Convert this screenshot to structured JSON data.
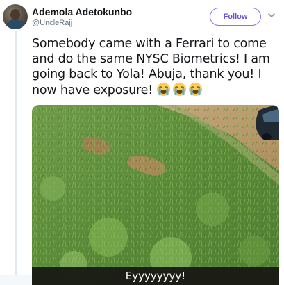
{
  "author": {
    "display_name": "Ademola Adetokunbo",
    "handle": "@UncleRajj"
  },
  "actions": {
    "follow_label": "Follow",
    "more_icon": "chevron-down-icon"
  },
  "tweet": {
    "text": "Somebody came with a Ferrari to come and do the same NYSC Biometrics! I am going back to Yola! Abuja, thank you! I now have exposure!",
    "emojis": [
      "loudly-crying-face",
      "loudly-crying-face",
      "loudly-crying-face"
    ]
  },
  "media": {
    "caption": "Eyyyyyyyy!",
    "description_icons": [
      "grass-slope",
      "car-partial"
    ]
  },
  "colors": {
    "follow_accent": "#6b4fd8",
    "text": "#14171a",
    "muted": "#657786"
  }
}
